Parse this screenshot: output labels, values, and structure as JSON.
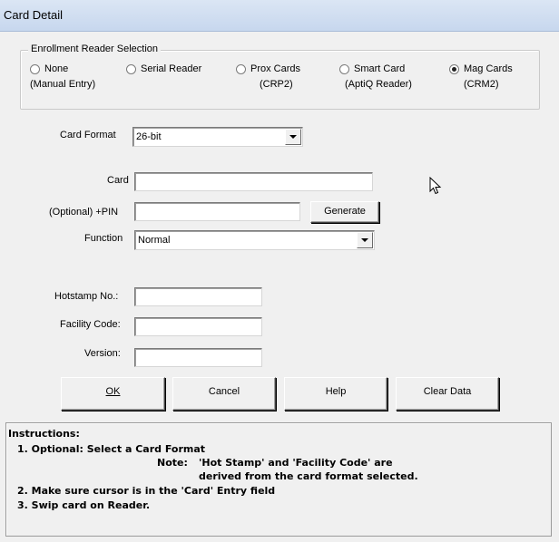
{
  "window": {
    "title": "Card Detail"
  },
  "enrollment": {
    "group_title": "Enrollment Reader Selection",
    "options": [
      {
        "line1": "None",
        "line2": "(Manual Entry)",
        "selected": false
      },
      {
        "line1": "Serial Reader",
        "line2": "",
        "selected": false
      },
      {
        "line1": "Prox Cards",
        "line2": "(CRP2)",
        "selected": false
      },
      {
        "line1": "Smart Card",
        "line2": "(AptiQ Reader)",
        "selected": false
      },
      {
        "line1": "Mag Cards",
        "line2": "(CRM2)",
        "selected": true
      }
    ]
  },
  "form": {
    "card_format_label": "Card Format",
    "card_format_value": "26-bit",
    "card_label": "Card",
    "card_value": "",
    "pin_label": "(Optional) +PIN",
    "pin_value": "",
    "generate_label": "Generate",
    "function_label": "Function",
    "function_value": "Normal",
    "hotstamp_label": "Hotstamp No.:",
    "hotstamp_value": "",
    "facility_label": "Facility Code:",
    "facility_value": "",
    "version_label": "Version:",
    "version_value": ""
  },
  "buttons": {
    "ok": "OK",
    "cancel": "Cancel",
    "help": "Help",
    "clear": "Clear Data"
  },
  "instructions": {
    "heading": "Instructions:",
    "step1": "1. Optional: Select a Card Format",
    "note_label": "Note:",
    "note_line1": "'Hot Stamp' and 'Facility Code' are",
    "note_line2": "derived from the card format selected.",
    "step2": "2. Make sure cursor is in the 'Card' Entry field",
    "step3": "3. Swip card on Reader."
  },
  "icons": {
    "cursor": "mouse-pointer-icon"
  }
}
